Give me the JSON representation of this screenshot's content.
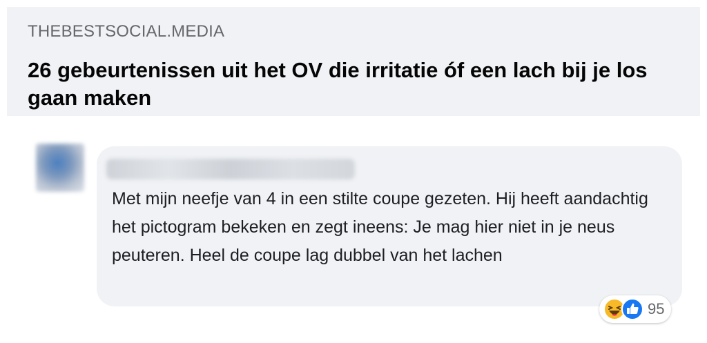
{
  "link_preview": {
    "domain": "THEBESTSOCIAL.MEDIA",
    "title": "26 gebeurtenissen uit het OV die irritatie óf een lach bij je los gaan maken"
  },
  "comment": {
    "text": "Met mijn neefje van 4 in een stilte coupe gezeten. Hij heeft aandachtig het pictogram bekeken en zegt ineens: Je mag hier niet in je neus peuteren. Heel de coupe lag dubbel van het lachen",
    "reactions": {
      "icons": [
        "haha-icon",
        "like-icon"
      ],
      "count": "95"
    }
  },
  "colors": {
    "card_bg": "#f0f2f5",
    "like_blue": "#1877f2",
    "haha_yellow": "#f7b928"
  }
}
